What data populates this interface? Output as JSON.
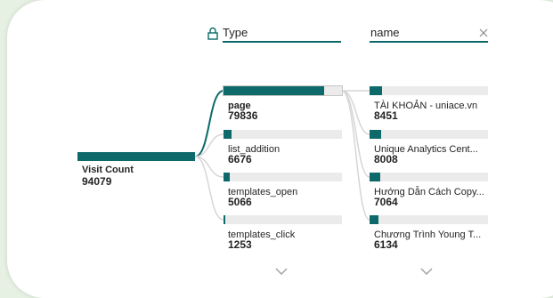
{
  "header": {
    "type_label": "Type",
    "name_label": "name"
  },
  "root": {
    "label": "Visit Count",
    "value": "94079"
  },
  "type_items": [
    {
      "label": "page",
      "value": "79836",
      "fraction": 0.849
    },
    {
      "label": "list_addition",
      "value": "6676",
      "fraction": 0.071
    },
    {
      "label": "templates_open",
      "value": "5066",
      "fraction": 0.054
    },
    {
      "label": "templates_click",
      "value": "1253",
      "fraction": 0.013
    }
  ],
  "name_items": [
    {
      "label": "TÀI KHOẢN - uniace.vn",
      "value": "8451",
      "fraction": 0.106
    },
    {
      "label": "Unique Analytics Cent...",
      "value": "8008",
      "fraction": 0.1
    },
    {
      "label": "Hướng Dẫn Cách Copy...",
      "value": "7064",
      "fraction": 0.088
    },
    {
      "label": "Chương Trình Young T...",
      "value": "6134",
      "fraction": 0.077
    }
  ],
  "colors": {
    "accent": "#0e6a6a",
    "track": "#ebebeb",
    "connector": "#d6d6d6"
  },
  "icons": {
    "lock": "lock-icon",
    "close": "close-icon",
    "more": "chevron-down-icon"
  }
}
